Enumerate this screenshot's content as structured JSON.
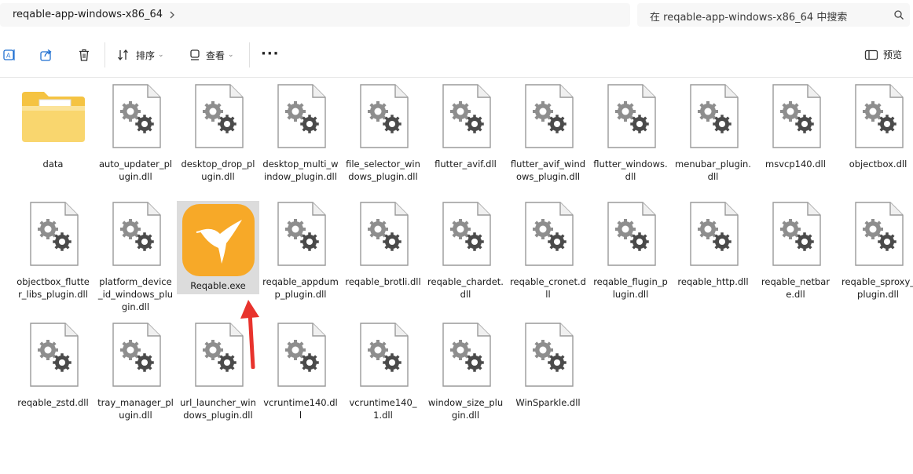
{
  "address": {
    "path": "reqable-app-windows-x86_64",
    "search_placeholder": "在 reqable-app-windows-x86_64 中搜索"
  },
  "toolbar": {
    "sort_label": "排序",
    "view_label": "查看",
    "more_label": "···",
    "preview_label": "预览"
  },
  "files": {
    "f0": "data",
    "f1": "auto_updater_plugin.dll",
    "f2": "desktop_drop_plugin.dll",
    "f3": "desktop_multi_window_plugin.dll",
    "f4": "file_selector_windows_plugin.dll",
    "f5": "flutter_avif.dll",
    "f6": "flutter_avif_windows_plugin.dll",
    "f7": "flutter_windows.dll",
    "f8": "menubar_plugin.dll",
    "f9": "msvcp140.dll",
    "f10": "objectbox.dll",
    "f11": "objectbox_flutter_libs_plugin.dll",
    "f12": "platform_device_id_windows_plugin.dll",
    "f13": "Reqable.exe",
    "f14": "reqable_appdump_plugin.dll",
    "f15": "reqable_brotli.dll",
    "f16": "reqable_chardet.dll",
    "f17": "reqable_cronet.dll",
    "f18": "reqable_flugin_plugin.dll",
    "f19": "reqable_http.dll",
    "f20": "reqable_netbare.dll",
    "f21": "reqable_sproxy_plugin.dll",
    "f22": "reqable_zstd.dll",
    "f23": "tray_manager_plugin.dll",
    "f24": "url_launcher_windows_plugin.dll",
    "f25": "vcruntime140.dll",
    "f26": "vcruntime140_1.dll",
    "f27": "window_size_plugin.dll",
    "f28": "WinSparkle.dll"
  },
  "colors": {
    "folder": "#f5c342",
    "app_icon": "#f7a928",
    "arrow": "#e8332d",
    "selection": "#dcdcdc"
  }
}
